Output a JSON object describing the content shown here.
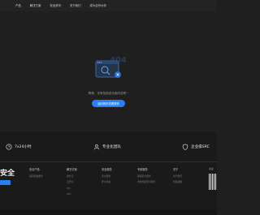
{
  "nav": {
    "items": [
      "产品",
      "解决方案",
      "安全资讯",
      "关于我们",
      "成为合作伙伴"
    ]
  },
  "main": {
    "error_code": "404",
    "message": "啊哦，没有找到该页面内容呢~",
    "home_button": "返回首页查看更多"
  },
  "features": [
    {
      "label": "7x24小时",
      "icon": "clock-icon"
    },
    {
      "label": "专业化团队",
      "icon": "team-icon"
    },
    {
      "label": "企业级SRC",
      "icon": "shield-icon"
    }
  ],
  "footer": {
    "logo": "安全",
    "columns": [
      {
        "heading": "安全产品",
        "links": [
          "漏洞扫描服务"
        ]
      },
      {
        "heading": "解决方案",
        "links": [
          "政务云",
          "云安全",
          "IDC",
          "SPC"
        ]
      },
      {
        "heading": "安全服务",
        "links": [
          "安全服务",
          "安全评估"
        ]
      },
      {
        "heading": "专家服务",
        "links": [
          "等保安全服务",
          "渗透测试安全服务"
        ]
      },
      {
        "heading": "关于",
        "links": [
          "关于我们",
          "隐私政策"
        ]
      }
    ],
    "qr_label": "关注"
  },
  "colors": {
    "accent": "#2a7ff2",
    "background": "#1f1f1f",
    "footer": "#1a1a1a"
  }
}
